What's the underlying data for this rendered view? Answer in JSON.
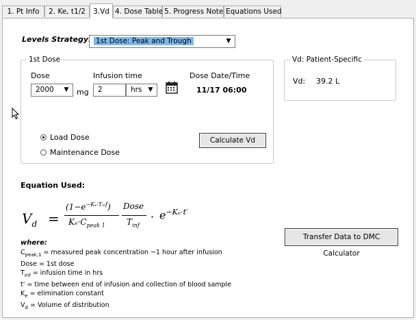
{
  "tabs": [
    {
      "label": "1. Pt Info",
      "hot": "1"
    },
    {
      "label": "2. Ke, t1/2",
      "hot": "2"
    },
    {
      "label": "3.Vd",
      "hot": "3"
    },
    {
      "label": "4. Dose Table",
      "hot": "4"
    },
    {
      "label": "5. Progress Note",
      "hot": ""
    },
    {
      "label": "Equations Used",
      "hot": ""
    }
  ],
  "strategy": {
    "label": "Levels Strategy:",
    "value": "1st Dose: Peak and Trough"
  },
  "first_dose": {
    "legend": "1st Dose",
    "dose_label": "Dose",
    "dose_value": "2000",
    "dose_unit": "mg",
    "infusion_label": "Infusion time",
    "infusion_value": "2",
    "infusion_unit": "hrs",
    "datetime_label": "Dose Date/Time",
    "datetime_value": "11/17 06:00",
    "load_dose": "Load Dose",
    "maintenance_dose": "Maintenance Dose",
    "calculate_button": "Calculate Vd"
  },
  "vd_box": {
    "legend": "Vd: Patient-Specific",
    "label": "Vd:",
    "value": "39.2 L"
  },
  "equation": {
    "heading": "Equation Used:",
    "lhs": "V",
    "lhs_sub": "d",
    "equals": "=",
    "num1": "(1−e",
    "num1_sup": "−Kₑ·Tᵢₙf",
    "num1_end": ")",
    "den1": "Kₑ·C",
    "den1_sub": "peak 1",
    "num2": "Dose",
    "den2": "T",
    "den2_sub": "inf",
    "mult": "·",
    "exp_base": "e",
    "exp_sup": "−Kₑ·t′"
  },
  "where": {
    "title": "where:",
    "lines": [
      {
        "sym": "C",
        "sub": "peak,1",
        "text": " = measured peak concentration ~1 hour after infusion"
      },
      {
        "sym": "Dose",
        "sub": "",
        "text": " = 1st dose"
      },
      {
        "sym": "T",
        "sub": "inf",
        "text": " = infusion time in hrs"
      },
      {
        "sym": "t'",
        "sub": "",
        "text": " = time between end of infusion and collection of blood sample"
      },
      {
        "sym": "K",
        "sub": "e",
        "text": " = elimination constant"
      },
      {
        "sym": "V",
        "sub": "d",
        "text": " = Volume of distribution"
      }
    ]
  },
  "transfer_button": {
    "label": "Transfer Data to DMC Calculator",
    "hot": "T"
  },
  "icons": {
    "calendar": "calendar-icon",
    "cursor": "mouse-pointer-icon"
  }
}
